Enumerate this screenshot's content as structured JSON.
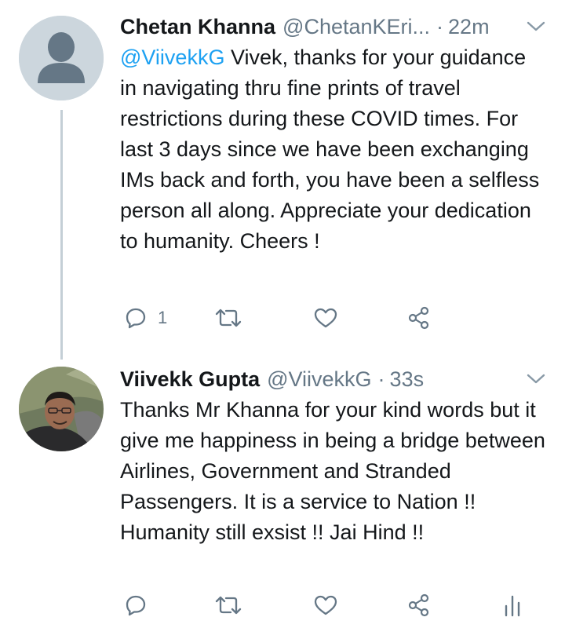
{
  "tweets": [
    {
      "name": "Chetan Khanna",
      "handle": "@ChetanKEri...",
      "separator": "·",
      "time": "22m",
      "mention": "@ViivekkG",
      "text": " Vivek, thanks for your guidance in navigating thru fine prints of travel restrictions during these COVID times. For last 3 days since we have been exchanging IMs back and forth, you have been a selfless person all along. Appreciate your dedication to humanity. Cheers !",
      "reply_count": "1",
      "icons": [
        "reply-icon",
        "retweet-icon",
        "like-icon",
        "share-icon",
        "chevron-down-icon"
      ]
    },
    {
      "name": "Viivekk Gupta",
      "handle": "@ViivekkG",
      "separator": "·",
      "time": "33s",
      "text": "Thanks Mr Khanna for your kind words but it give me happiness in being a bridge between Airlines, Government and Stranded Passengers. It is a service to Nation !! Humanity still exsist !! Jai Hind !!",
      "icons": [
        "reply-icon",
        "retweet-icon",
        "like-icon",
        "share-icon",
        "analytics-icon",
        "chevron-down-icon"
      ]
    }
  ],
  "colors": {
    "text": "#14171a",
    "secondary": "#657786",
    "link": "#1da1f2",
    "thread_line": "#c4cfd6"
  }
}
